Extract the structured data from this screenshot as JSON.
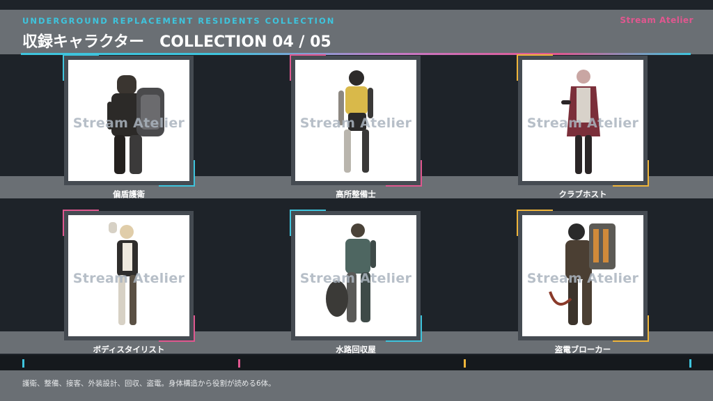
{
  "header": {
    "subtitle": "UNDERGROUND REPLACEMENT RESIDENTS COLLECTION",
    "title": "収録キャラクター　COLLECTION 04 / 05",
    "brand": "Stream Atelier"
  },
  "characters": [
    {
      "label": "偏盾護衛",
      "watermark": "Stream Atelier",
      "accent": "cyan"
    },
    {
      "label": "高所整備士",
      "watermark": "Stream Atelier",
      "accent": "pink"
    },
    {
      "label": "クラブホスト",
      "watermark": "Stream Atelier",
      "accent": "yellow"
    },
    {
      "label": "ボディスタイリスト",
      "watermark": "Stream Atelier",
      "accent": "pink"
    },
    {
      "label": "水路回収屋",
      "watermark": "Stream Atelier",
      "accent": "cyan"
    },
    {
      "label": "盗電ブローカー",
      "watermark": "Stream Atelier",
      "accent": "yellow"
    }
  ],
  "footer": {
    "text": "護衛、整備、接客、外装設計、回収、盗電。身体構造から役割が読める6体。"
  },
  "colors": {
    "cyan": "#3ec4dd",
    "pink": "#e0578f",
    "yellow": "#f0b53a",
    "panel": "#6a6f74",
    "background": "#1e2329"
  },
  "timeline_ticks": [
    "cyan",
    "pink",
    "yellow",
    "cyan"
  ]
}
